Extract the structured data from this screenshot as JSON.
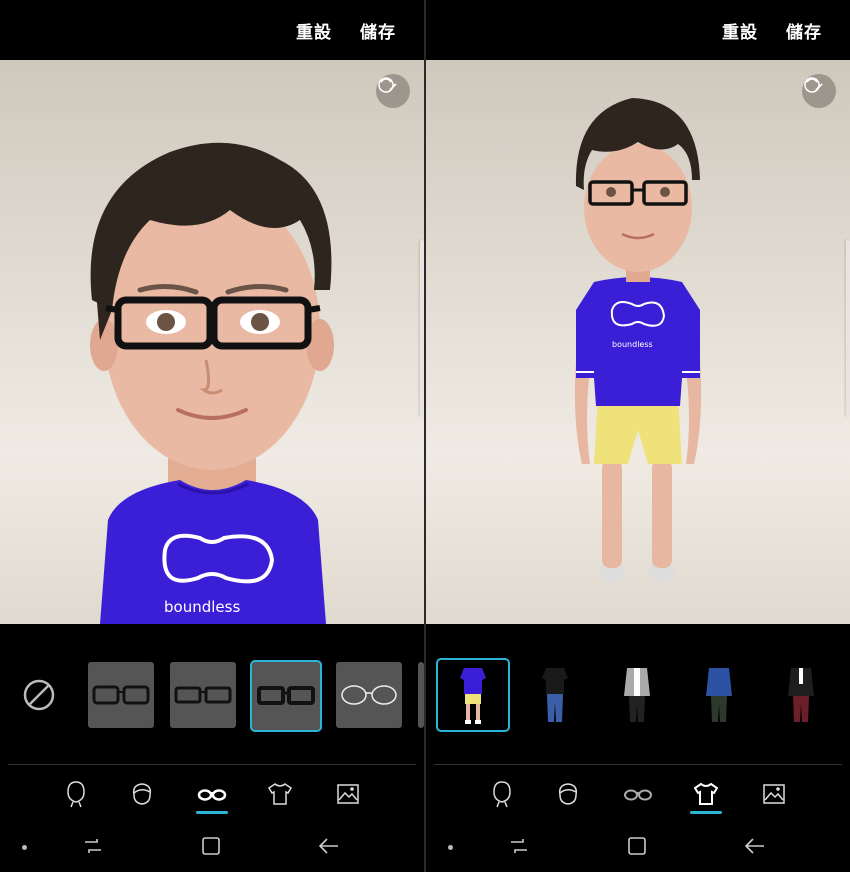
{
  "left": {
    "topbar": {
      "reset": "重設",
      "save": "儲存"
    },
    "shirt_text": "boundless",
    "picker_kind": "glasses",
    "tiles": [
      {
        "id": "glasses-1",
        "icon": "thick-rect-glasses-icon"
      },
      {
        "id": "glasses-2",
        "icon": "rect-glasses-icon"
      },
      {
        "id": "glasses-3",
        "icon": "thick-black-glasses-icon",
        "selected": true
      },
      {
        "id": "glasses-4",
        "icon": "thin-round-glasses-icon"
      }
    ],
    "active_tab": "glasses"
  },
  "right": {
    "topbar": {
      "reset": "重設",
      "save": "儲存"
    },
    "shirt_text": "boundless",
    "picker_kind": "outfits",
    "tiles": [
      {
        "id": "outfit-1",
        "icon": "purple-tee-yellow-shorts-outfit-icon",
        "selected": true
      },
      {
        "id": "outfit-2",
        "icon": "black-tee-jeans-outfit-icon"
      },
      {
        "id": "outfit-3",
        "icon": "gray-jacket-outfit-icon"
      },
      {
        "id": "outfit-4",
        "icon": "blue-denim-jacket-outfit-icon"
      },
      {
        "id": "outfit-5",
        "icon": "black-blazer-outfit-icon"
      }
    ],
    "active_tab": "clothing"
  },
  "tabs": [
    "face-icon",
    "hair-icon",
    "glasses-icon",
    "shirt-icon",
    "background-image-icon"
  ],
  "colors": {
    "accent": "#2bb4d6",
    "shirt": "#3b1fd6",
    "shorts": "#f0e27a",
    "skin": "#e9b9a2",
    "hair": "#2f251f"
  }
}
